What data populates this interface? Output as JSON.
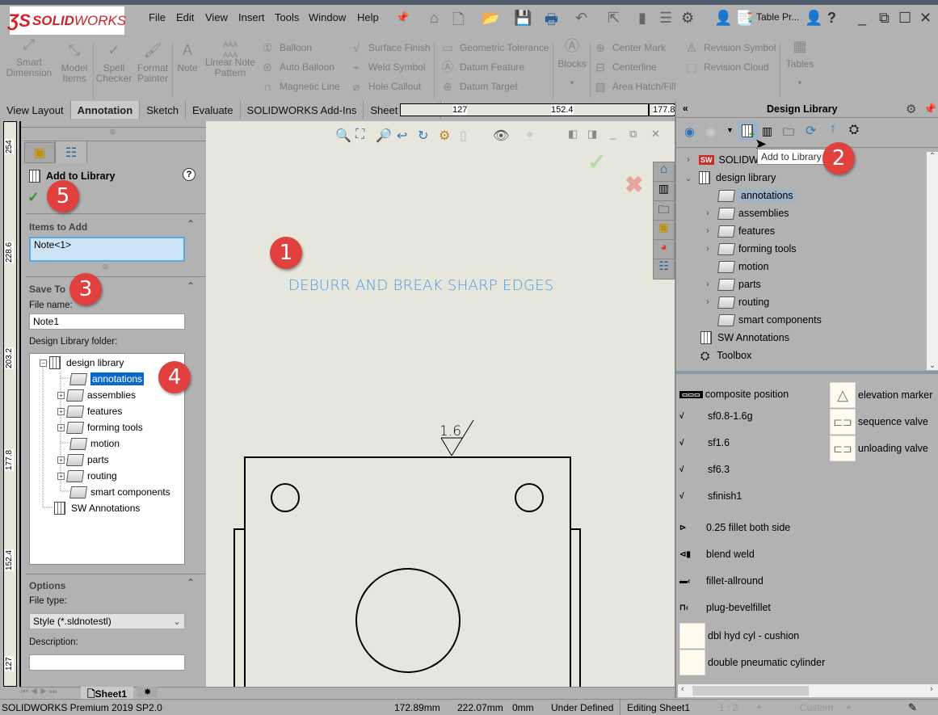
{
  "app": {
    "brand": "SOLIDWORKS",
    "brand_bold": "SOLID",
    "brand_light": "WORKS"
  },
  "menu": [
    "File",
    "Edit",
    "View",
    "Insert",
    "Tools",
    "Window",
    "Help"
  ],
  "quick_access": {
    "table_pr_label": "Table Pr...",
    "help": "?"
  },
  "command_manager": {
    "big": [
      {
        "label": "Smart\nDimension",
        "icon": "smart-dimension-icon"
      },
      {
        "label": "Model\nItems",
        "icon": "model-items-icon"
      },
      {
        "label": "Spell\nChecker",
        "icon": "spell-checker-icon"
      },
      {
        "label": "Format\nPainter",
        "icon": "format-painter-icon"
      },
      {
        "label": "Note",
        "icon": "note-icon"
      },
      {
        "label": "Linear Note\nPattern",
        "icon": "linear-note-pattern-icon"
      }
    ],
    "col1": [
      "Balloon",
      "Auto Balloon",
      "Magnetic Line"
    ],
    "col2": [
      "Surface Finish",
      "Weld Symbol",
      "Hole Callout"
    ],
    "col3": [
      "Geometric Tolerance",
      "Datum Feature",
      "Datum Target"
    ],
    "blocks": "Blocks",
    "col4": [
      "Center Mark",
      "Centerline",
      "Area Hatch/Fill"
    ],
    "col5": [
      "Revision Symbol",
      "Revision Cloud"
    ],
    "tables": "Tables"
  },
  "tabs": [
    "View Layout",
    "Annotation",
    "Sketch",
    "Evaluate",
    "SOLIDWORKS Add-Ins",
    "Sheet Format"
  ],
  "active_tab": "Annotation",
  "hruler": [
    "127",
    "152.4",
    "177.8"
  ],
  "vruler": [
    "254",
    "228.6",
    "203.2",
    "177.8",
    "152.4",
    "127"
  ],
  "property_manager": {
    "title": "Add to Library",
    "items_to_add": {
      "header": "Items to Add",
      "value": "Note<1>"
    },
    "save_to": {
      "header": "Save To",
      "file_name_label": "File name:",
      "file_name": "Note1",
      "folder_label": "Design Library folder:"
    },
    "tree": {
      "root": "design library",
      "children": [
        {
          "label": "annotations",
          "expandable": false,
          "selected": true
        },
        {
          "label": "assemblies",
          "expandable": true
        },
        {
          "label": "features",
          "expandable": true
        },
        {
          "label": "forming tools",
          "expandable": true
        },
        {
          "label": "motion",
          "expandable": false
        },
        {
          "label": "parts",
          "expandable": true
        },
        {
          "label": "routing",
          "expandable": true
        },
        {
          "label": "smart components",
          "expandable": false
        }
      ],
      "sibling": "SW Annotations"
    },
    "options": {
      "header": "Options",
      "file_type_label": "File type:",
      "file_type": "Style (*.sldnotestl)",
      "description_label": "Description:",
      "description": ""
    }
  },
  "sheet_tab": "Sheet1",
  "canvas": {
    "note_text": "DEBURR AND BREAK SHARP EDGES",
    "surface_finish_value": "1.6"
  },
  "design_library": {
    "title": "Design Library",
    "tooltip": "Add to Library",
    "tree": [
      {
        "label": "SOLIDWORKS Content",
        "visible_label": "SOLIDW",
        "level": 0,
        "chevron": "right",
        "icon": "sw-icon"
      },
      {
        "label": "design library",
        "level": 0,
        "chevron": "down",
        "icon": "library-icon"
      },
      {
        "label": "annotations",
        "level": 1,
        "chevron": "",
        "icon": "folder-icon",
        "selected": true
      },
      {
        "label": "assemblies",
        "level": 1,
        "chevron": "right",
        "icon": "folder-icon"
      },
      {
        "label": "features",
        "level": 1,
        "chevron": "right",
        "icon": "folder-icon"
      },
      {
        "label": "forming tools",
        "level": 1,
        "chevron": "right",
        "icon": "folder-icon"
      },
      {
        "label": "motion",
        "level": 1,
        "chevron": "",
        "icon": "folder-icon"
      },
      {
        "label": "parts",
        "level": 1,
        "chevron": "right",
        "icon": "folder-icon"
      },
      {
        "label": "routing",
        "level": 1,
        "chevron": "right",
        "icon": "folder-icon"
      },
      {
        "label": "smart components",
        "level": 1,
        "chevron": "",
        "icon": "folder-icon"
      },
      {
        "label": "SW Annotations",
        "level": 0,
        "chevron": "",
        "icon": "library-icon"
      },
      {
        "label": "Toolbox",
        "level": 0,
        "chevron": "",
        "icon": "toolbox-icon"
      }
    ],
    "items_left": [
      "composite position",
      "sf0.8-1.6g",
      "sf1.6",
      "sf6.3",
      "sfinish1",
      "0.25 fillet both side",
      "blend weld",
      "fillet-allround",
      "plug-bevelfillet",
      "dbl hyd cyl - cushion",
      "double pneumatic cylinder"
    ],
    "items_right": [
      "elevation marker",
      "sequence valve",
      "unloading valve"
    ]
  },
  "callouts": [
    "1",
    "2",
    "3",
    "4",
    "5"
  ],
  "status_bar": {
    "product": "SOLIDWORKS Premium 2019 SP2.0",
    "x": "172.89mm",
    "y": "222.07mm",
    "z": "0mm",
    "state": "Under Defined",
    "editing": "Editing Sheet1",
    "scale": "1 : 2",
    "units": "Custom"
  },
  "colors": {
    "note": "#4a9be0",
    "badge": "#e0413f",
    "selection": "#0a68cc"
  }
}
